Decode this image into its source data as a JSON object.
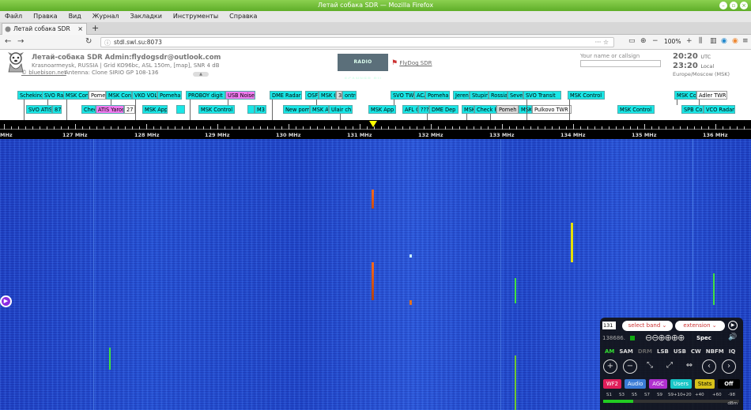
{
  "window": {
    "title": "Летай собака SDR — Mozilla Firefox"
  },
  "menu": [
    "Файл",
    "Правка",
    "Вид",
    "Журнал",
    "Закладки",
    "Инструменты",
    "Справка"
  ],
  "tab": {
    "label": "Летай собака SDR",
    "new_tab": "+"
  },
  "nav": {
    "url": "stdl.swl.su:8073",
    "zoom": "100%"
  },
  "header": {
    "title": "Летай-собака SDR Admin:flydogsdr@outlook.com",
    "location": "Krasnoarmeysk, RUSSIA | Grid KO96bc, ASL 150m, [map], SNR 4 dB",
    "antenna": "Antenna: Clone SIRIO GP 108-136",
    "blog_link": "© bluebison.net",
    "radioscanner_banner": "RADIO SCANNER.RU",
    "flydog_link": "FlyDog SDR",
    "callsign_placeholder": "Your name or callsign",
    "time_utc": "20:20",
    "utc_label": "UTC",
    "time_local": "23:20",
    "local_label": "Local",
    "timezone": "Europe/Moscow (MSK)",
    "collapse_icon": "chevron-up-icon"
  },
  "labels_row1": [
    "Schekino",
    "SVO Ra",
    "MSK Con",
    "Pomeh",
    "MSK Con",
    "VKO VOL",
    "Pomeha",
    "PROBOY digit",
    "USB Noise",
    "DME Radar",
    "OSF",
    "MSK C",
    "3",
    "ontrol",
    "SVO TW",
    "ACA",
    "Pomeha",
    "Jeren",
    "Stupin",
    "Rossia",
    "Seve",
    "SVO Transit",
    "MSK Control",
    "MSK Co",
    "Adler TWR"
  ],
  "labels_row2": [
    "SVO ATIS",
    "87",
    "Chec",
    "ATIS Yaros",
    "27",
    "MSK App",
    "",
    "MSK Control",
    "",
    "M3",
    "New pom",
    "MSK A",
    "Ulair ch",
    "MSK App",
    "AFL C",
    "???",
    "DME Dep",
    "MSK",
    "Check R",
    "Pomeh",
    "MSK",
    "Pulkovo TWR",
    "MSK Control",
    "SPB Co",
    "VCO Radar"
  ],
  "scale": {
    "labels": [
      "MHz",
      "127 MHz",
      "128 MHz",
      "129 MHz",
      "130 MHz",
      "131 MHz",
      "132 MHz",
      "133 MHz",
      "134 MHz",
      "135 MHz",
      "136 MHz"
    ]
  },
  "panel": {
    "freq_input": "131",
    "band_select": "select band",
    "extension_select": "extension",
    "freq_readout": "138686.",
    "spec_label": "Spec",
    "modes": [
      "AM",
      "SAM",
      "DRM",
      "LSB",
      "USB",
      "CW",
      "NBFM",
      "IQ"
    ],
    "active_mode": "AM",
    "buttons": [
      {
        "label": "WF2",
        "color": "#e01e5a"
      },
      {
        "label": "Audio",
        "color": "#3a7bd5"
      },
      {
        "label": "AGC",
        "color": "#b030d0"
      },
      {
        "label": "Users",
        "color": "#19c6c6"
      },
      {
        "label": "Stats",
        "color": "#d6c01a"
      },
      {
        "label": "Off",
        "color": "#000000"
      }
    ],
    "smeter_scale": [
      "S1",
      "S3",
      "S5",
      "S7",
      "S9",
      "S9+10",
      "+20",
      "+40",
      "+60",
      "-98"
    ],
    "smeter_unit": "dBm"
  },
  "colors": {
    "label_cyan": "#19e6e6",
    "label_pink": "#f07bf0",
    "marker_yellow": "#ffff00"
  }
}
